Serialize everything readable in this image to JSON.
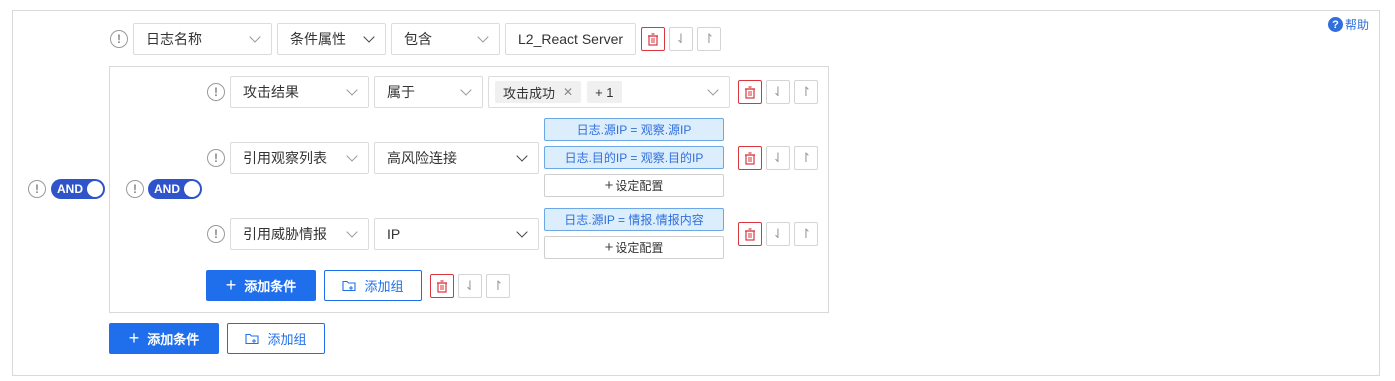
{
  "help": {
    "label": "帮助",
    "icon": "question-circle-icon"
  },
  "root": {
    "logic": "AND",
    "condition": {
      "field": "日志名称",
      "op": "条件属性",
      "match": "包含",
      "value": "L2_React Server"
    },
    "group": {
      "logic": "AND",
      "rows": [
        {
          "field": "攻击结果",
          "op": "属于",
          "tags": [
            "攻击成功",
            "+ 1"
          ]
        },
        {
          "field": "引用观察列表",
          "op": "高风险连接",
          "chips": [
            "日志.源IP = 观察.源IP",
            "日志.目的IP = 观察.目的IP"
          ],
          "config": "设定配置"
        },
        {
          "field": "引用威胁情报",
          "op": "IP",
          "chips": [
            "日志.源IP = 情报.情报内容"
          ],
          "config": "设定配置"
        }
      ],
      "add_condition": "添加条件",
      "add_group": "添加组"
    },
    "add_condition": "添加条件",
    "add_group": "添加组"
  },
  "colors": {
    "primary": "#1f6fec",
    "toggle": "#2f53c9",
    "danger": "#d9363e",
    "chip_bg": "#dceefb"
  }
}
